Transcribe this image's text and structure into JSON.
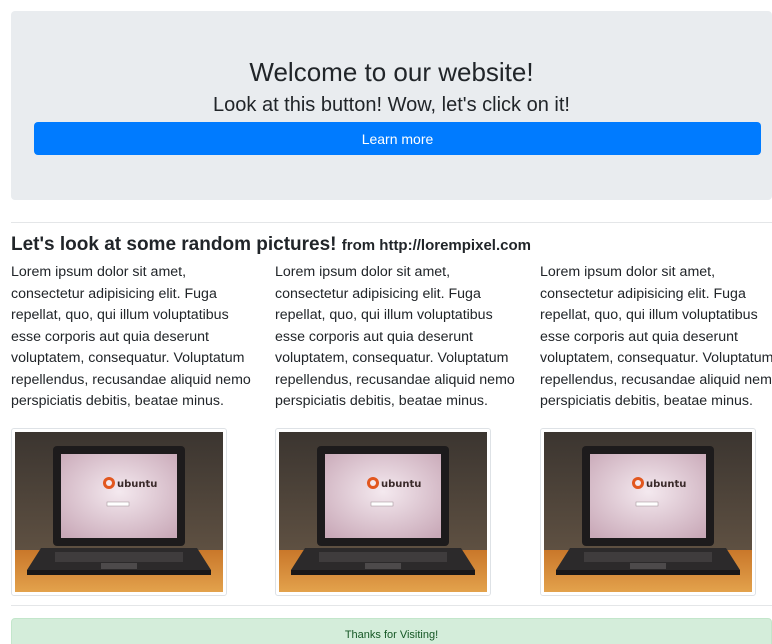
{
  "hero": {
    "title": "Welcome to our website!",
    "subtitle": "Look at this button! Wow, let's click on it!",
    "button_label": "Learn more"
  },
  "gallery": {
    "heading": "Let's look at some random pictures!",
    "source_prefix": "from",
    "source_url": "http://lorempixel.com",
    "columns": [
      {
        "text": "Lorem ipsum dolor sit amet, consectetur adipisicing elit. Fuga repellat, quo, qui illum voluptatibus esse corporis aut quia deserunt voluptatem, consequatur. Voluptatum repellendus, recusandae aliquid nemo perspiciatis debitis, beatae minus.",
        "image_logo_text": "ubuntu"
      },
      {
        "text": "Lorem ipsum dolor sit amet, consectetur adipisicing elit. Fuga repellat, quo, qui illum voluptatibus esse corporis aut quia deserunt voluptatem, consequatur. Voluptatum repellendus, recusandae aliquid nemo perspiciatis debitis, beatae minus.",
        "image_logo_text": "ubuntu"
      },
      {
        "text": "Lorem ipsum dolor sit amet, consectetur adipisicing elit. Fuga repellat, quo, qui illum voluptatibus esse corporis aut quia deserunt voluptatem, consequatur. Voluptatum repellendus, recusandae aliquid nemo perspiciatis debitis, beatae minus.",
        "image_logo_text": "ubuntu"
      }
    ]
  },
  "footer": {
    "message": "Thanks for Visiting!"
  },
  "colors": {
    "primary": "#007bff",
    "jumbotron_bg": "#e9ecef",
    "success_bg": "#d4edda",
    "success_text": "#155724"
  }
}
